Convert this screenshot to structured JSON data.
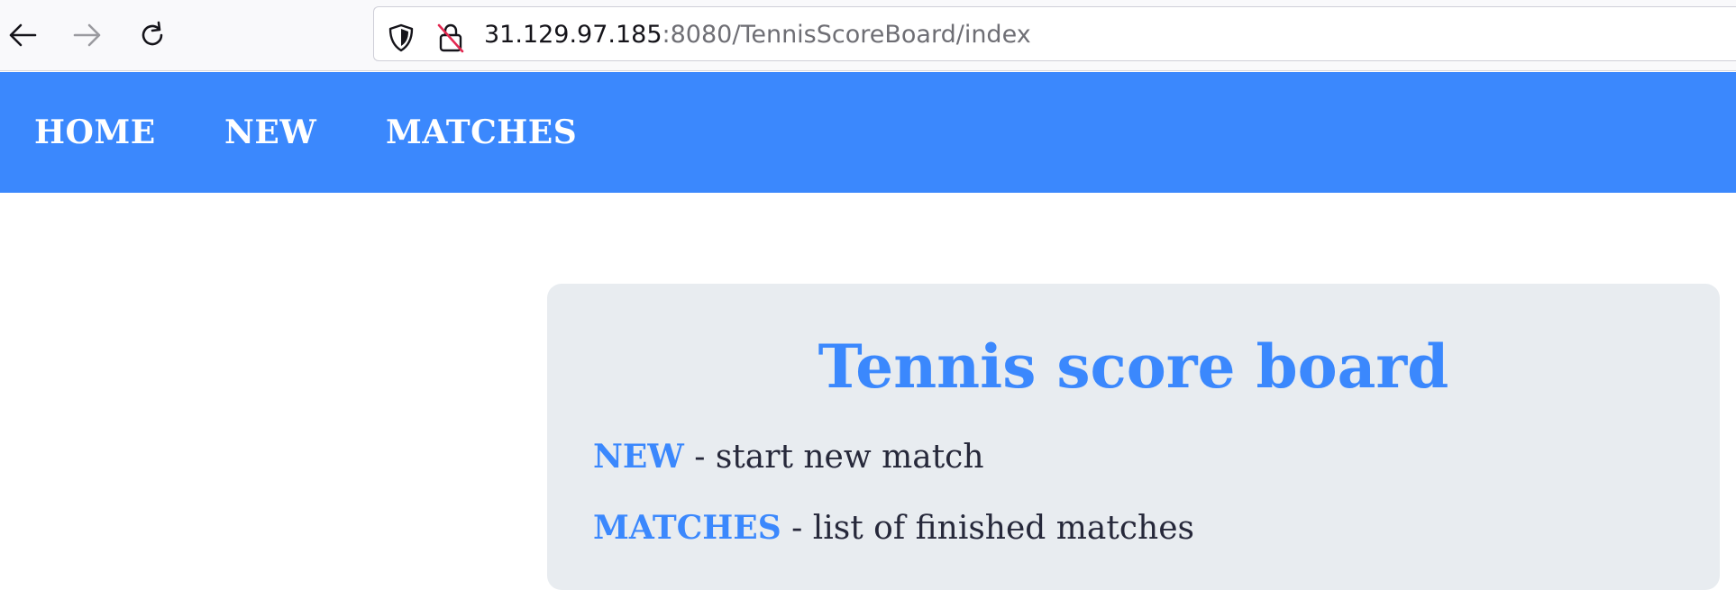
{
  "browser": {
    "back_icon": "back-arrow-icon",
    "forward_icon": "forward-arrow-icon",
    "reload_icon": "reload-icon",
    "shield_icon": "tracking-protection-shield-icon",
    "insecure_icon": "insecure-connection-lock-icon",
    "url_host": "31.129.97.185",
    "url_rest": ":8080/TennisScoreBoard/index"
  },
  "nav": {
    "home": "HOME",
    "new": "NEW",
    "matches": "MATCHES"
  },
  "main": {
    "title": "Tennis score board",
    "new_link": "NEW",
    "new_desc": " - start new match",
    "matches_link": "MATCHES",
    "matches_desc": " - list of finished matches"
  },
  "colors": {
    "accent": "#3b88fd",
    "card_background": "#e8ecf0",
    "text": "#26283a"
  }
}
